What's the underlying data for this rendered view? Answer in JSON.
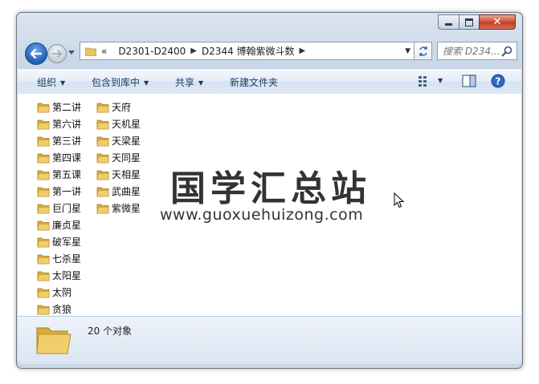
{
  "address": {
    "overflow": "«",
    "crumbs": [
      "D2301-D2400",
      "D2344 博翰紫微斗数"
    ]
  },
  "search": {
    "placeholder": "搜索 D234..."
  },
  "toolbar": {
    "organize": "组织",
    "include_in_library": "包含到库中",
    "share": "共享",
    "new_folder": "新建文件夹"
  },
  "folders": {
    "column1": [
      "第二讲",
      "第六讲",
      "第三讲",
      "第四课",
      "第五课",
      "第一讲",
      "巨门星",
      "廉贞星",
      "破军星",
      "七杀星",
      "太阳星",
      "太阴",
      "贪狼"
    ],
    "column2": [
      "天府",
      "天机星",
      "天梁星",
      "天同星",
      "天相星",
      "武曲星",
      "紫微星"
    ]
  },
  "watermark": {
    "title": "国学汇总站",
    "url": "www.guoxuehuizong.com"
  },
  "details": {
    "count_text": "20 个对象"
  },
  "colors": {
    "folder": "#e9c45a",
    "accent": "#1e395b"
  }
}
